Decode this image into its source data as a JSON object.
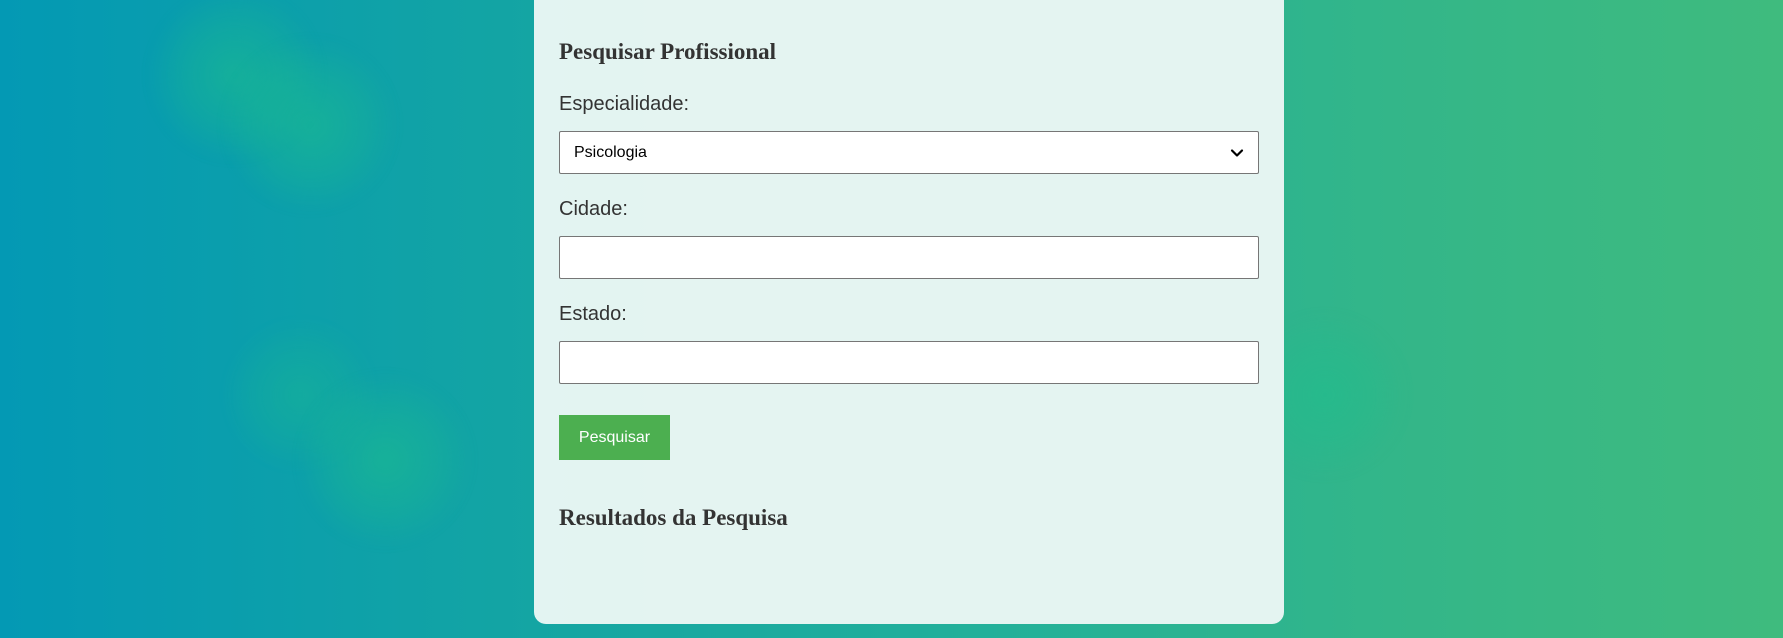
{
  "search_form": {
    "title": "Pesquisar Profissional",
    "specialty": {
      "label": "Especialidade:",
      "selected": "Psicologia"
    },
    "city": {
      "label": "Cidade:",
      "value": "",
      "placeholder": ""
    },
    "state": {
      "label": "Estado:",
      "value": "",
      "placeholder": ""
    },
    "submit_label": "Pesquisar"
  },
  "results": {
    "title": "Resultados da Pesquisa"
  },
  "colors": {
    "button": "#4caf50",
    "background_start": "#0399b4",
    "background_end": "#3fbb7e",
    "card": "#ecf7f5",
    "text": "#333333"
  },
  "icons": {
    "select_arrow": "chevron-down-icon"
  }
}
